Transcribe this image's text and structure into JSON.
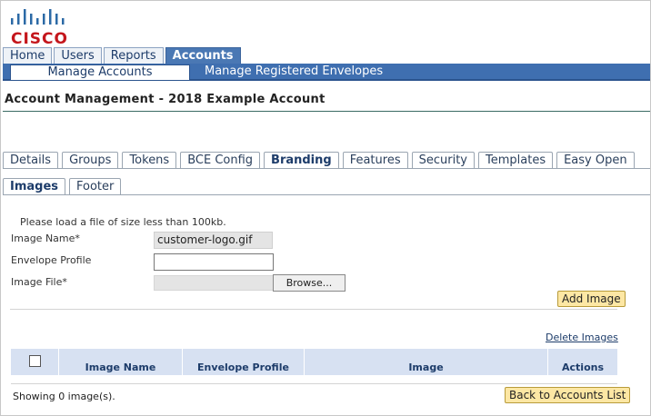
{
  "brand": {
    "logo_text": "CISCO",
    "color": "#c4161c"
  },
  "top_nav": {
    "tabs": [
      {
        "label": "Home",
        "active": false
      },
      {
        "label": "Users",
        "active": false
      },
      {
        "label": "Reports",
        "active": false
      },
      {
        "label": "Accounts",
        "active": true
      }
    ],
    "sub_tabs": [
      {
        "label": "Manage Accounts",
        "active": true
      },
      {
        "label": "Manage Registered Envelopes",
        "active": false
      }
    ]
  },
  "page_title": "Account Management - 2018 Example Account",
  "section_tabs": [
    {
      "label": "Details",
      "active": false
    },
    {
      "label": "Groups",
      "active": false
    },
    {
      "label": "Tokens",
      "active": false
    },
    {
      "label": "BCE Config",
      "active": false
    },
    {
      "label": "Branding",
      "active": true
    },
    {
      "label": "Features",
      "active": false
    },
    {
      "label": "Security",
      "active": false
    },
    {
      "label": "Templates",
      "active": false
    },
    {
      "label": "Easy Open",
      "active": false
    }
  ],
  "branding_tabs": [
    {
      "label": "Images",
      "active": true
    },
    {
      "label": "Footer",
      "active": false
    }
  ],
  "form": {
    "note": "Please load a file of size less than 100kb.",
    "image_name_label": "Image Name*",
    "image_name_value": "customer-logo.gif",
    "envelope_profile_label": "Envelope Profile",
    "envelope_profile_value": "",
    "image_file_label": "Image File*",
    "browse_label": "Browse...",
    "add_image_label": "Add Image"
  },
  "images_table": {
    "delete_link": "Delete Images",
    "columns": [
      "",
      "Image Name",
      "Envelope Profile",
      "Image",
      "Actions"
    ],
    "rows": [],
    "showing_text": "Showing 0 image(s).",
    "back_label": "Back to Accounts List"
  },
  "colors": {
    "nav_blue": "#3f6fb0",
    "header_blue": "#d7e1f2",
    "button_yellow": "#fde7a4"
  }
}
